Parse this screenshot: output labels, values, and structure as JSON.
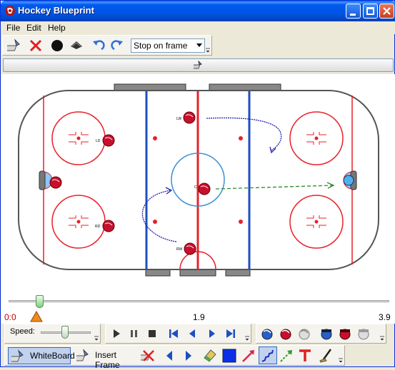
{
  "window": {
    "title": "Hockey Blueprint"
  },
  "menu": {
    "file": "File",
    "edit": "Edit",
    "help": "Help"
  },
  "toolbar": {
    "stop_mode": "Stop on frame"
  },
  "rink": {
    "players": [
      {
        "label": "LW",
        "team": "offense"
      },
      {
        "label": "LD",
        "team": "offense"
      },
      {
        "label": "C",
        "team": "offense"
      },
      {
        "label": "RD",
        "team": "offense"
      },
      {
        "label": "RW",
        "team": "offense"
      }
    ],
    "colors": {
      "red_line": "#e8202a",
      "blue_line": "#1d4fbf",
      "circle_blue": "#3a8fd8",
      "pass_arrow": "#2d8a2d",
      "skate_path": "#2020b0",
      "board": "#555555"
    }
  },
  "timeline": {
    "start": "0:0",
    "mid": "1.9",
    "end": "3.9",
    "position": 0.09
  },
  "playback": {
    "speed_label": "Speed:",
    "speed_level": 0.55
  },
  "tools": {
    "whiteboard": "WhiteBoard",
    "insert_frame": "Insert Frame"
  }
}
